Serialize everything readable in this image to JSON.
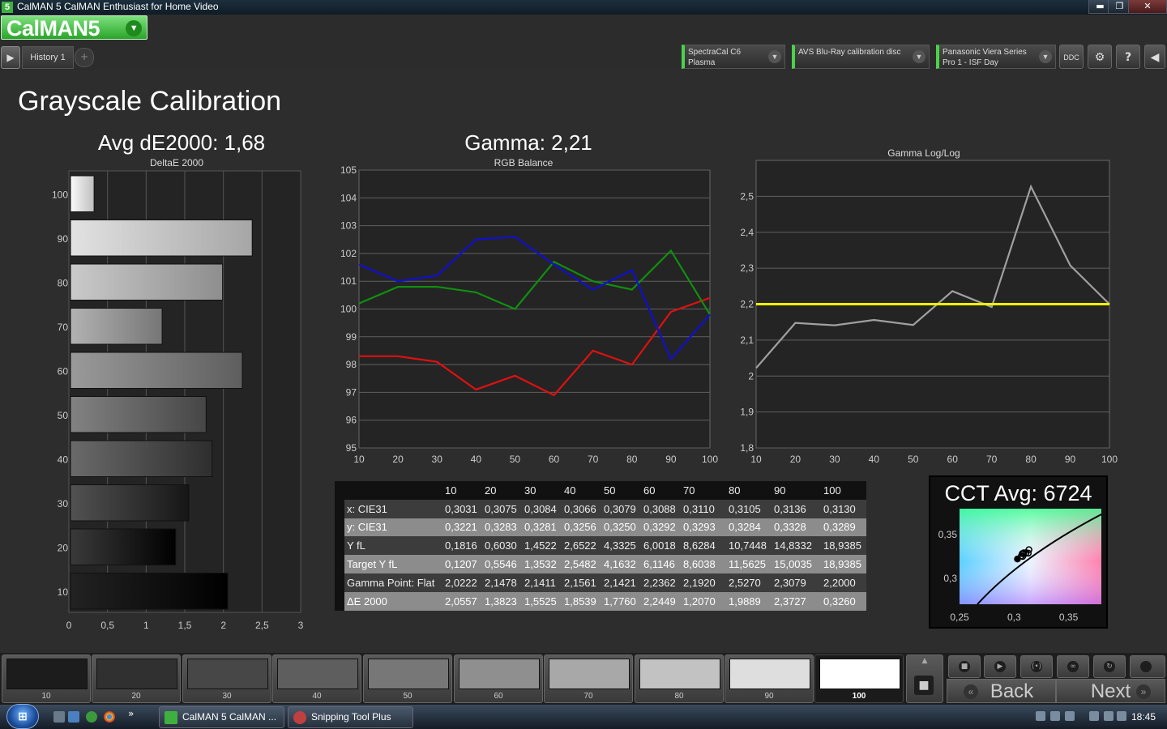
{
  "window": {
    "title": "CalMAN 5 CalMAN Enthusiast for Home Video",
    "min": "▬",
    "restore": "❐",
    "close": "✕"
  },
  "header": {
    "logo": "CalMAN5",
    "history_tab": "History 1",
    "add_tab": "+",
    "devices": [
      {
        "line1": "SpectraCal C6",
        "line2": "Plasma"
      },
      {
        "line1": "AVS Blu-Ray calibration disc",
        "line2": ""
      },
      {
        "line1": "Panasonic Viera Series",
        "line2": "Pro 1 - ISF Day"
      }
    ],
    "ddc_label": "DDC",
    "settings_icon": "⚙",
    "help_icon": "?",
    "collapse_icon": "◀"
  },
  "page": {
    "title": "Grayscale Calibration"
  },
  "panels": {
    "de_title": "Avg dE2000: 1,68",
    "de_subtitle": "DeltaE 2000",
    "gamma_title": "Gamma: 2,21",
    "rgb_subtitle": "RGB Balance",
    "loglog_title": "Gamma Log/Log",
    "cct_title": "CCT Avg: 6724"
  },
  "chart_data": [
    {
      "type": "bar",
      "orientation": "horizontal",
      "title": "Avg dE2000: 1,68",
      "subtitle": "DeltaE 2000",
      "categories": [
        "100",
        "90",
        "80",
        "70",
        "60",
        "50",
        "40",
        "30",
        "20",
        "10"
      ],
      "values": [
        0.326,
        2.3727,
        1.9889,
        1.207,
        2.2449,
        1.776,
        1.8539,
        1.5525,
        1.3823,
        2.0557
      ],
      "xlim": [
        0,
        3
      ],
      "xticks": [
        "0",
        "0,5",
        "1",
        "1,5",
        "2",
        "2,5",
        "3"
      ],
      "grid": true
    },
    {
      "type": "line",
      "title": "Gamma: 2,21",
      "subtitle": "RGB Balance",
      "x": [
        10,
        20,
        30,
        40,
        50,
        60,
        70,
        80,
        90,
        100
      ],
      "series": [
        {
          "color": "#e01010",
          "values": [
            98.3,
            98.3,
            98.1,
            97.1,
            97.6,
            96.9,
            98.5,
            98.0,
            99.9,
            100.4
          ]
        },
        {
          "color": "#109010",
          "values": [
            100.2,
            100.8,
            100.8,
            100.6,
            100.0,
            101.7,
            101.0,
            100.7,
            102.1,
            99.8
          ]
        },
        {
          "color": "#1010d0",
          "values": [
            101.6,
            101.0,
            101.2,
            102.5,
            102.6,
            101.6,
            100.7,
            101.4,
            98.2,
            99.8
          ]
        }
      ],
      "xlim": [
        10,
        100
      ],
      "ylim": [
        95,
        105
      ],
      "xticks": [
        "10",
        "20",
        "30",
        "40",
        "50",
        "60",
        "70",
        "80",
        "90",
        "100"
      ],
      "yticks": [
        "95",
        "96",
        "97",
        "98",
        "99",
        "100",
        "101",
        "102",
        "103",
        "104",
        "105"
      ],
      "grid": true
    },
    {
      "type": "line",
      "title": "Gamma Log/Log",
      "x": [
        10,
        20,
        30,
        40,
        50,
        60,
        70,
        80,
        90,
        100
      ],
      "series": [
        {
          "color": "#a0a0a0",
          "values": [
            2.0222,
            2.1478,
            2.1411,
            2.1561,
            2.1421,
            2.2362,
            2.192,
            2.527,
            2.3079,
            2.2
          ]
        },
        {
          "color": "#f0f000",
          "values": [
            2.2,
            2.2,
            2.2,
            2.2,
            2.2,
            2.2,
            2.2,
            2.2,
            2.2,
            2.2
          ]
        }
      ],
      "xlim": [
        10,
        100
      ],
      "ylim": [
        1.8,
        2.6
      ],
      "xticks": [
        "10",
        "20",
        "30",
        "40",
        "50",
        "60",
        "70",
        "80",
        "90",
        "100"
      ],
      "yticks": [
        "1,8",
        "1,9",
        "2",
        "2,1",
        "2,2",
        "2,3",
        "2,4",
        "2,5"
      ],
      "grid": true
    },
    {
      "type": "scatter",
      "title": "CCT Avg: 6724",
      "xlim": [
        0.25,
        0.38
      ],
      "ylim": [
        0.27,
        0.38
      ],
      "xticks": [
        "0,25",
        "0,3",
        "0,35"
      ],
      "yticks": [
        "0,3",
        "0,35"
      ],
      "points_x": [
        0.3031,
        0.3075,
        0.3084,
        0.3066,
        0.3079,
        0.3088,
        0.311,
        0.3105,
        0.3136,
        0.313
      ],
      "points_y": [
        0.3221,
        0.3283,
        0.3281,
        0.3256,
        0.325,
        0.3292,
        0.3293,
        0.3284,
        0.3328,
        0.3289
      ]
    }
  ],
  "table": {
    "columns": [
      "10",
      "20",
      "30",
      "40",
      "50",
      "60",
      "70",
      "80",
      "90",
      "100"
    ],
    "rows": [
      {
        "label": "x: CIE31",
        "values": [
          "0,3031",
          "0,3075",
          "0,3084",
          "0,3066",
          "0,3079",
          "0,3088",
          "0,3110",
          "0,3105",
          "0,3136",
          "0,3130"
        ]
      },
      {
        "label": "y: CIE31",
        "values": [
          "0,3221",
          "0,3283",
          "0,3281",
          "0,3256",
          "0,3250",
          "0,3292",
          "0,3293",
          "0,3284",
          "0,3328",
          "0,3289"
        ]
      },
      {
        "label": "Y fL",
        "values": [
          "0,1816",
          "0,6030",
          "1,4522",
          "2,6522",
          "4,3325",
          "6,0018",
          "8,6284",
          "10,7448",
          "14,8332",
          "18,9385"
        ]
      },
      {
        "label": "Target Y fL",
        "values": [
          "0,1207",
          "0,5546",
          "1,3532",
          "2,5482",
          "4,1632",
          "6,1146",
          "8,6038",
          "11,5625",
          "15,0035",
          "18,9385"
        ]
      },
      {
        "label": "Gamma Point: Flat",
        "values": [
          "2,0222",
          "2,1478",
          "2,1411",
          "2,1561",
          "2,1421",
          "2,2362",
          "2,1920",
          "2,5270",
          "2,3079",
          "2,2000"
        ]
      },
      {
        "label": "ΔE 2000",
        "values": [
          "2,0557",
          "1,3823",
          "1,5525",
          "1,8539",
          "1,7760",
          "2,2449",
          "1,2070",
          "1,9889",
          "2,3727",
          "0,3260"
        ]
      }
    ]
  },
  "swatches": [
    {
      "label": "10",
      "color": "#1c1c1c"
    },
    {
      "label": "20",
      "color": "#303030"
    },
    {
      "label": "30",
      "color": "#474747"
    },
    {
      "label": "40",
      "color": "#5e5e5e"
    },
    {
      "label": "50",
      "color": "#777777"
    },
    {
      "label": "60",
      "color": "#8f8f8f"
    },
    {
      "label": "70",
      "color": "#a8a8a8"
    },
    {
      "label": "80",
      "color": "#c2c2c2"
    },
    {
      "label": "90",
      "color": "#dedede"
    },
    {
      "label": "100",
      "color": "#ffffff"
    }
  ],
  "controls": {
    "back": "Back",
    "next": "Next",
    "back_arrow": "«",
    "next_arrow": "»",
    "stop_icon": "■",
    "play_icon": "▶",
    "read_icon": "⟨•⟩",
    "loop_icon": "∞",
    "refresh_icon": "↻",
    "up_icon": "▲"
  },
  "taskbar": {
    "start": "⊞",
    "tasks": [
      "CalMAN 5 CalMAN ...",
      "Snipping Tool Plus"
    ],
    "clock": "18:45",
    "show_more": "»"
  }
}
